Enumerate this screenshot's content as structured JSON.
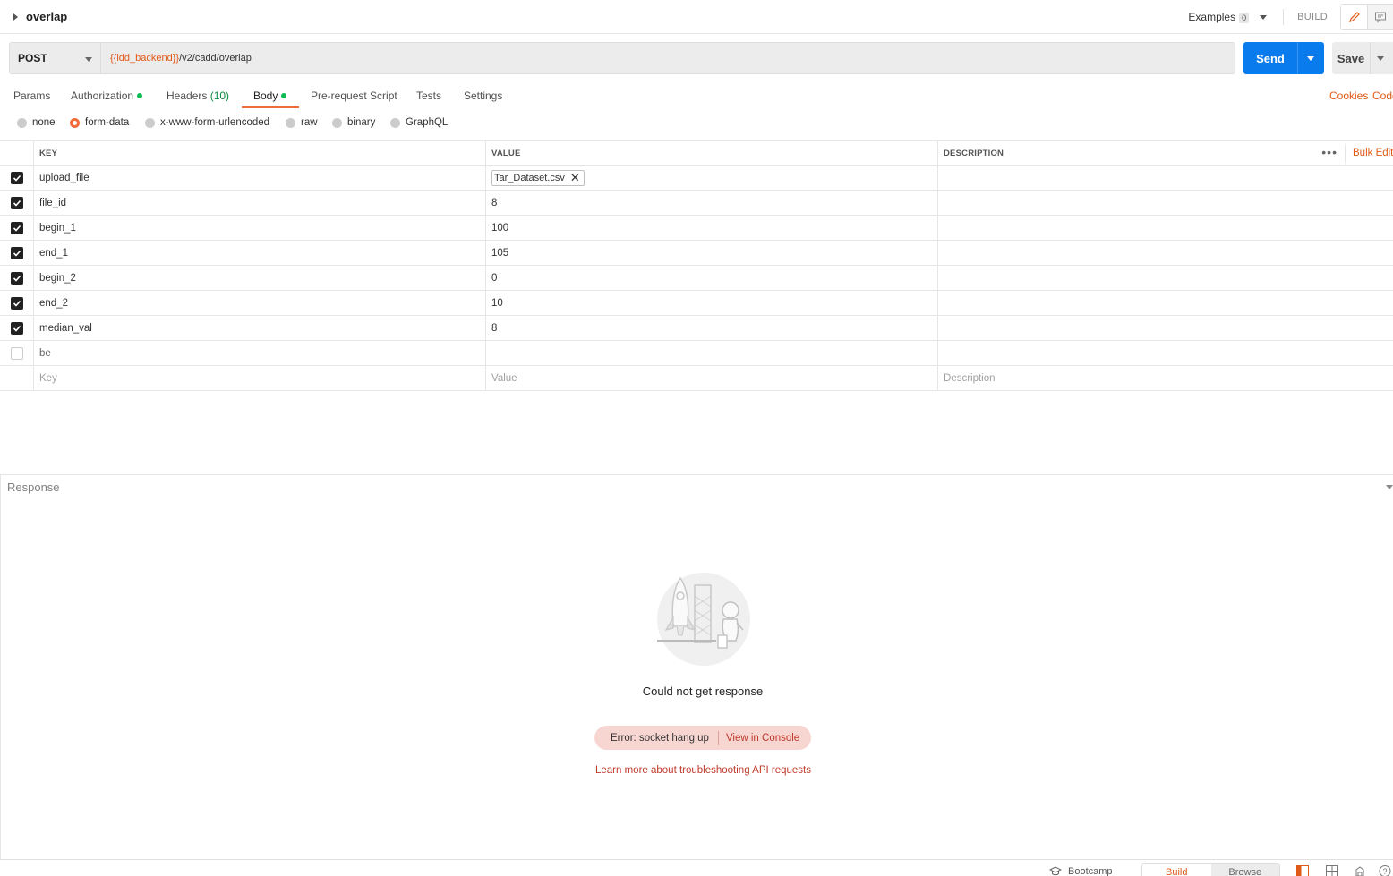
{
  "header": {
    "title": "overlap",
    "examples_label": "Examples",
    "examples_count": "0",
    "build_label": "BUILD"
  },
  "request": {
    "method": "POST",
    "url_variable": "{{idd_backend}}",
    "url_path": "/v2/cadd/overlap",
    "send_label": "Send",
    "save_label": "Save"
  },
  "tabs": [
    {
      "label": "Params"
    },
    {
      "label": "Authorization",
      "dot": true
    },
    {
      "label": "Headers",
      "count": "(10)"
    },
    {
      "label": "Body",
      "dot": true,
      "active": true
    },
    {
      "label": "Pre-request Script"
    },
    {
      "label": "Tests"
    },
    {
      "label": "Settings"
    }
  ],
  "tab_links": {
    "cookies": "Cookies",
    "code": "Code"
  },
  "body_types": [
    {
      "label": "none",
      "selected": false
    },
    {
      "label": "form-data",
      "selected": true
    },
    {
      "label": "x-www-form-urlencoded",
      "selected": false
    },
    {
      "label": "raw",
      "selected": false
    },
    {
      "label": "binary",
      "selected": false
    },
    {
      "label": "GraphQL",
      "selected": false
    }
  ],
  "table": {
    "columns": {
      "key": "KEY",
      "value": "VALUE",
      "description": "DESCRIPTION"
    },
    "bulk_edit": "Bulk Edit",
    "rows": [
      {
        "checked": true,
        "key": "upload_file",
        "value": "Tar_Dataset.csv",
        "is_file": true
      },
      {
        "checked": true,
        "key": "file_id",
        "value": "8"
      },
      {
        "checked": true,
        "key": "begin_1",
        "value": "100"
      },
      {
        "checked": true,
        "key": "end_1",
        "value": "105"
      },
      {
        "checked": true,
        "key": "begin_2",
        "value": "0"
      },
      {
        "checked": true,
        "key": "end_2",
        "value": "10"
      },
      {
        "checked": true,
        "key": "median_val",
        "value": "8"
      },
      {
        "checked": false,
        "key": "be",
        "value": ""
      }
    ],
    "placeholders": {
      "key": "Key",
      "value": "Value",
      "description": "Description"
    }
  },
  "response": {
    "label": "Response",
    "empty_message": "Could not get response",
    "error_text": "Error: socket hang up",
    "console_link": "View in Console",
    "learn_more": "Learn more about troubleshooting API requests"
  },
  "footer": {
    "bootcamp": "Bootcamp",
    "build": "Build",
    "browse": "Browse"
  },
  "colors": {
    "accent": "#f26b3a",
    "send": "#097bed",
    "active_dot": "#0cbb52",
    "error_bg": "#f7d6d2"
  }
}
